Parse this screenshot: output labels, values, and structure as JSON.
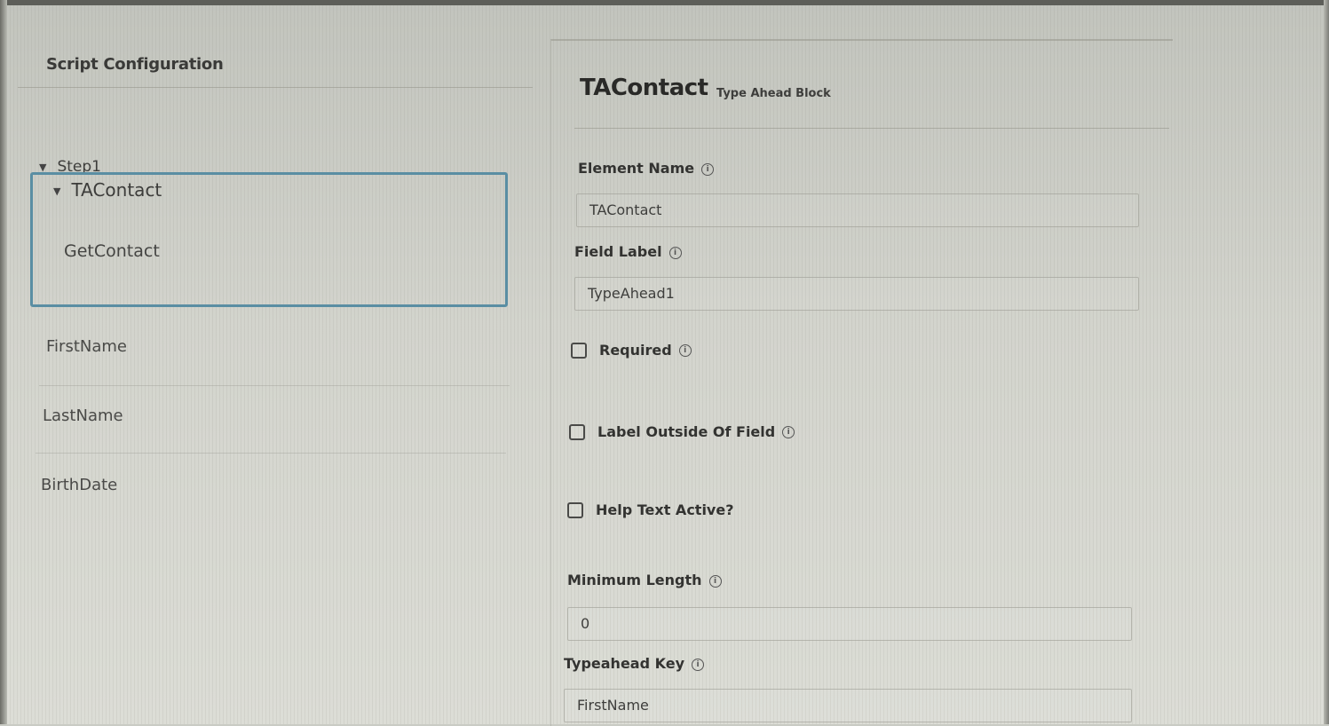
{
  "left": {
    "header_title": "Script Configuration",
    "step": "Step1",
    "block": "TAContact",
    "block_child": "GetContact",
    "elements": [
      "FirstName",
      "LastName",
      "BirthDate"
    ]
  },
  "right": {
    "title": "TAContact",
    "subtitle": "Type Ahead Block",
    "element_name_label": "Element Name",
    "element_name_value": "TAContact",
    "field_label_label": "Field Label",
    "field_label_value": "TypeAhead1",
    "required_label": "Required",
    "label_outside_label": "Label Outside Of Field",
    "help_text_label": "Help Text Active?",
    "minimum_length_label": "Minimum Length",
    "minimum_length_value": "0",
    "typeahead_key_label": "Typeahead Key",
    "typeahead_key_value": "FirstName"
  },
  "icons": {
    "info": "info-icon",
    "caret": "caret-down-icon"
  },
  "colors": {
    "selection_border": "#5a8ea3"
  }
}
